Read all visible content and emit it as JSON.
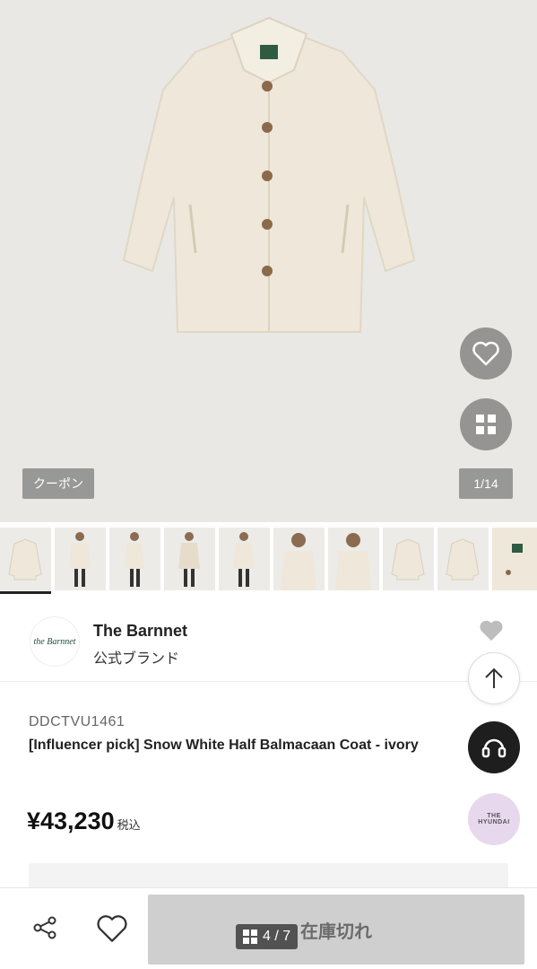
{
  "hero": {
    "coupon_label": "クーポン",
    "counter": "1/14"
  },
  "thumbnails": {
    "count": 10,
    "active_index": 0
  },
  "brand": {
    "logo_text": "the Barnnet",
    "name": "The Barnnet",
    "subtitle": "公式ブランド"
  },
  "floating": {
    "hyundai_label_top": "THE",
    "hyundai_label": "HYUNDAI"
  },
  "product": {
    "sku": "DDCTVU1461",
    "title": "[Influencer pick] Snow White Half Balmacaan Coat - ivory",
    "price": "¥43,230",
    "tax_label": "税込"
  },
  "bottom_bar": {
    "soldout_label": "在庫切れ",
    "pager": "4 / 7"
  },
  "colors": {
    "coat": "#efe8da",
    "button_brown": "#8a6a4a",
    "hero_bg": "#e9e8e4"
  },
  "icons": [
    "heart-icon",
    "grid-icon",
    "arrow-up-icon",
    "headset-icon",
    "share-icon",
    "heart-outline-icon",
    "pages-icon"
  ]
}
